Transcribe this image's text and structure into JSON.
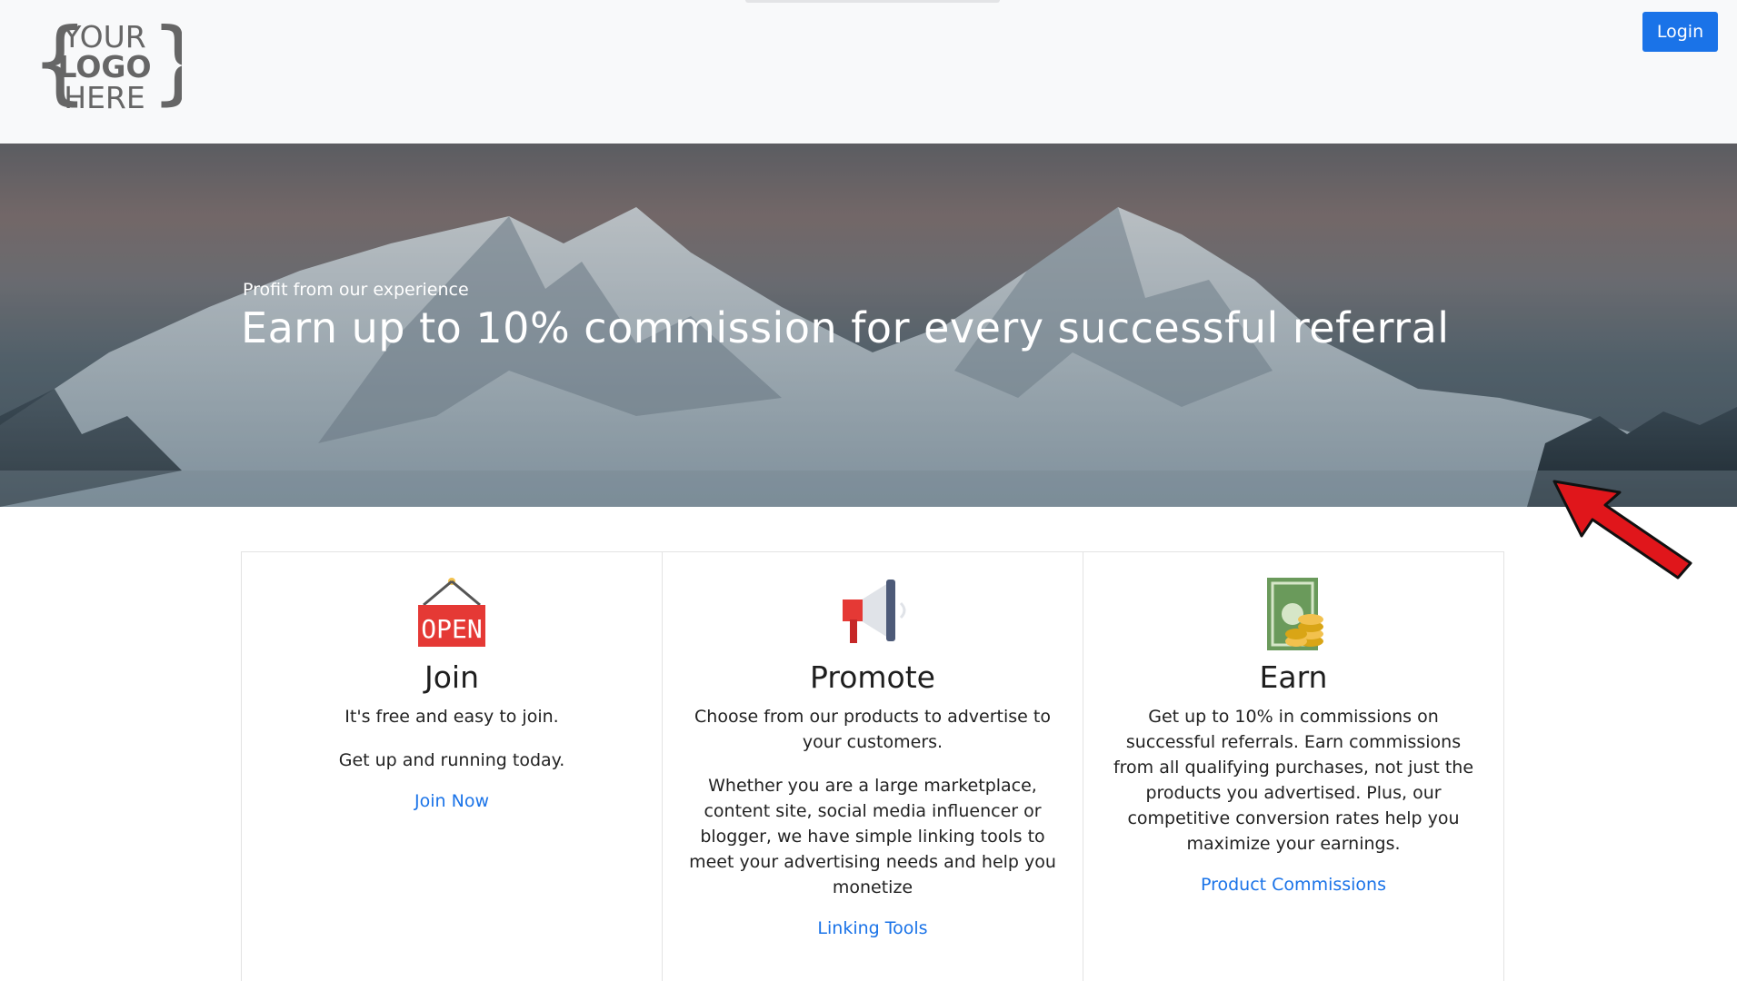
{
  "header": {
    "logo": {
      "line1": "YOUR",
      "line2": "LOGO",
      "line3": "HERE"
    },
    "login_label": "Login"
  },
  "hero": {
    "subtitle": "Profit from our experience",
    "title": "Earn up to 10% commission for every successful referral"
  },
  "cards": [
    {
      "icon": "open-sign-icon",
      "title": "Join",
      "paragraphs": [
        "It's free and easy to join.",
        "Get up and running today."
      ],
      "link": "Join Now"
    },
    {
      "icon": "megaphone-icon",
      "title": "Promote",
      "paragraphs": [
        "Choose from our products to advertise to your customers.",
        "Whether you are a large marketplace, content site, social media influencer or blogger, we have simple linking tools to meet your advertising needs and help you monetize"
      ],
      "link": "Linking Tools"
    },
    {
      "icon": "money-coins-icon",
      "title": "Earn",
      "paragraphs": [
        "Get up to 10% in commissions on successful referrals. Earn commissions from all qualifying purchases, not just the products you advertised. Plus, our competitive conversion rates help you maximize your earnings."
      ],
      "link": "Product Commissions"
    }
  ],
  "colors": {
    "accent": "#1a73e8",
    "header_bg": "#f8f9fa",
    "arrow": "#e0161b"
  }
}
